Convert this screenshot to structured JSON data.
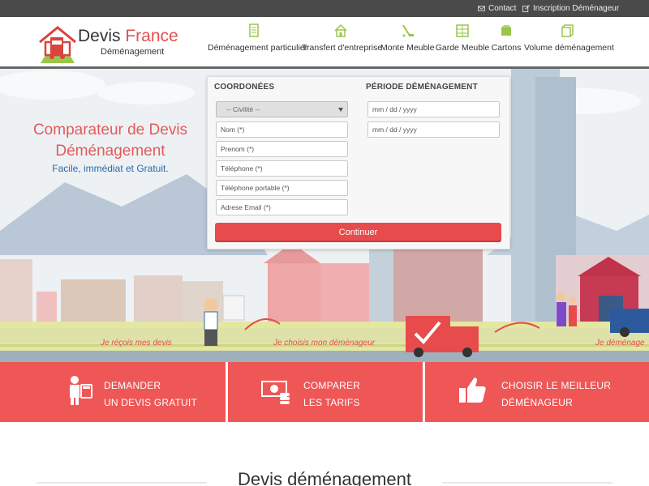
{
  "topbar": {
    "contact": "Contact",
    "inscription": "Inscription Déménageur"
  },
  "logo": {
    "title_part1": "Devis ",
    "title_part2": "France",
    "subtitle": "Déménagement"
  },
  "nav": [
    {
      "label": "Déménagement particulier",
      "icon": "document-icon"
    },
    {
      "label": "Transfert d'entreprise",
      "icon": "house-icon"
    },
    {
      "label": "Monte Meuble",
      "icon": "lift-icon"
    },
    {
      "label": "Garde Meuble",
      "icon": "storage-icon"
    },
    {
      "label": "Cartons",
      "icon": "box-icon"
    },
    {
      "label": "Volume déménagement",
      "icon": "cube-icon"
    }
  ],
  "hero": {
    "title": "Comparateur de Devis Déménagement",
    "subtitle": "Facile, immédiat et Gratuit.",
    "road_texts": [
      "Je réçois mes devis",
      "Je choisis mon déménageur",
      "Je déménage"
    ]
  },
  "form": {
    "coords_heading": "COORDONÉES",
    "period_heading": "PÉRIODE DÉMÉNAGEMENT",
    "civility": "-- Civilité --",
    "nom": "Nom (*)",
    "prenom": "Prenom  (*)",
    "telephone": "Téléphone (*)",
    "telephone_portable": "Téléphone portable (*)",
    "email": "Adrese Email (*)",
    "date1": "mm / dd / yyyy",
    "date2": "mm / dd / yyyy",
    "submit": "Continuer"
  },
  "features": [
    {
      "text": "DEMANDER\nUN DEVIS GRATUIT",
      "icon": "man-calculator-icon"
    },
    {
      "text": "COMPARER\nLES TARIFS",
      "icon": "money-icon"
    },
    {
      "text": "CHOISIR LE MEILLEUR\nDÉMÉNAGEUR",
      "icon": "thumbs-up-icon"
    }
  ],
  "section_title": "Devis déménagement",
  "colors": {
    "accent": "#ef5656",
    "topbar": "#4a4a4a",
    "link_blue": "#2b6aa8"
  }
}
